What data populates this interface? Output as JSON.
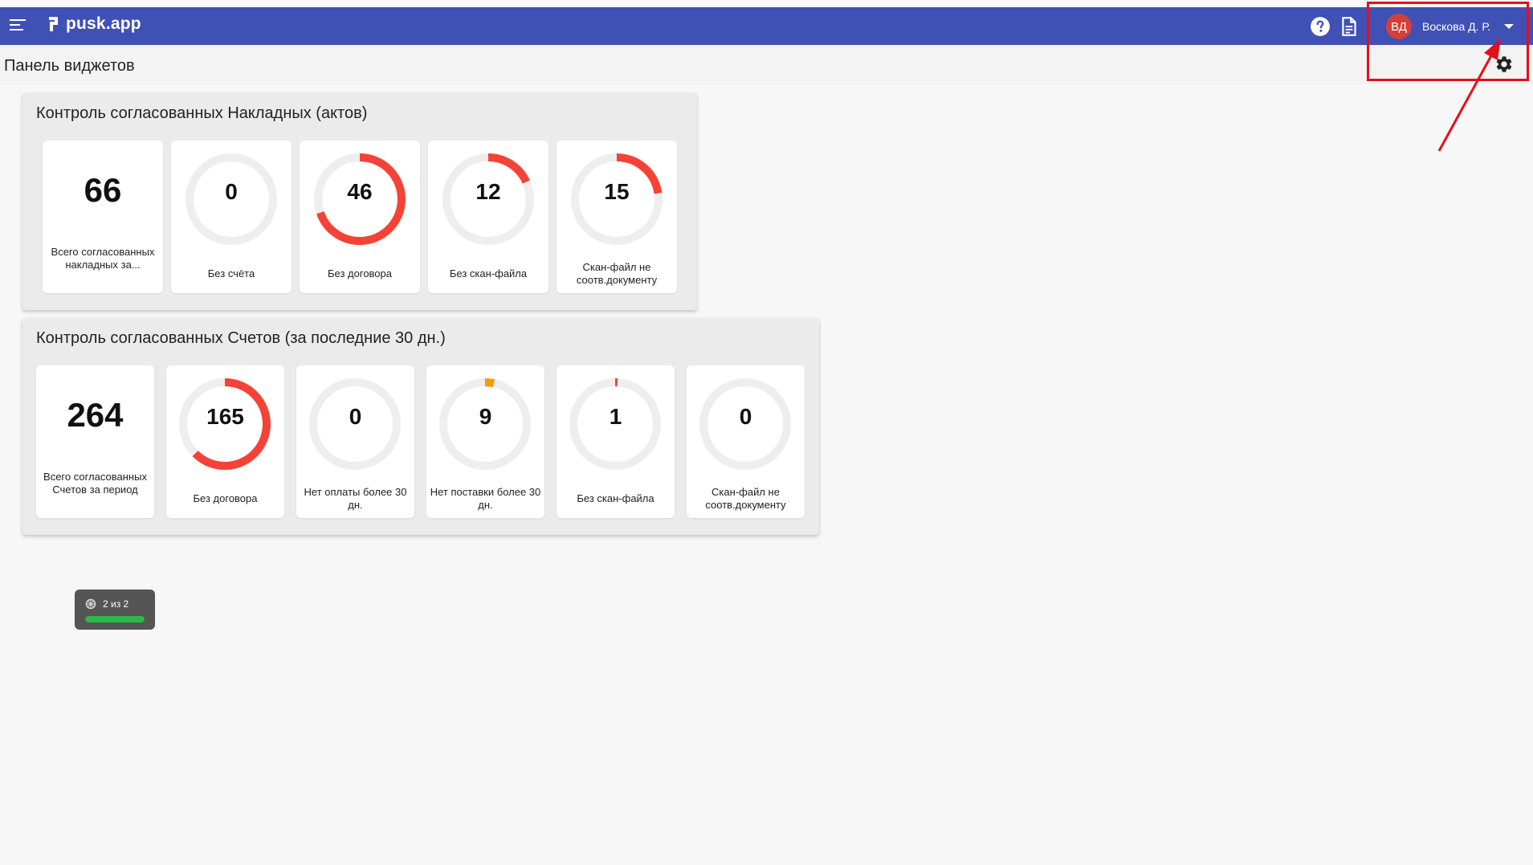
{
  "header": {
    "logo_text": "pusk.app",
    "user_initials": "ВД",
    "user_name": "Воскова Д. Р."
  },
  "page": {
    "title": "Панель виджетов"
  },
  "widgets": [
    {
      "title": "Контроль согласованных Накладных (актов)",
      "total": {
        "value": "66",
        "label": "Всего согласованных накладных за..."
      },
      "donuts": [
        {
          "value": "0",
          "label": "Без счёта",
          "fraction": 0
        },
        {
          "value": "46",
          "label": "Без договора",
          "fraction": 0.697
        },
        {
          "value": "12",
          "label": "Без скан-файла",
          "fraction": 0.182
        },
        {
          "value": "15",
          "label": "Скан-файл не соотв.документу",
          "fraction": 0.227
        }
      ]
    },
    {
      "title": "Контроль согласованных Счетов (за последние 30 дн.)",
      "total": {
        "value": "264",
        "label": "Всего согласованных Счетов за период"
      },
      "donuts": [
        {
          "value": "165",
          "label": "Без договора",
          "fraction": 0.625
        },
        {
          "value": "0",
          "label": "Нет оплаты более 30 дн.",
          "fraction": 0
        },
        {
          "value": "9",
          "label": "Нет поставки более 30 дн.",
          "fraction": 0.034
        },
        {
          "value": "1",
          "label": "Без скан-файла",
          "fraction": 0.004
        },
        {
          "value": "0",
          "label": "Скан-файл не соотв.документу",
          "fraction": 0
        }
      ]
    }
  ],
  "progress": {
    "text": "2 из 2",
    "fraction": 1.0
  },
  "colors": {
    "header_bg": "#3f51b5",
    "donut_track": "#eeeeee",
    "donut_red": "#f44336",
    "donut_orange": "#ff9800",
    "highlight": "#e3101a",
    "progress_fill": "#2db84b"
  },
  "icons": [
    "menu-icon",
    "logo-icon",
    "help-icon",
    "document-icon",
    "chevron-down-icon",
    "gear-icon",
    "spinner-icon"
  ]
}
